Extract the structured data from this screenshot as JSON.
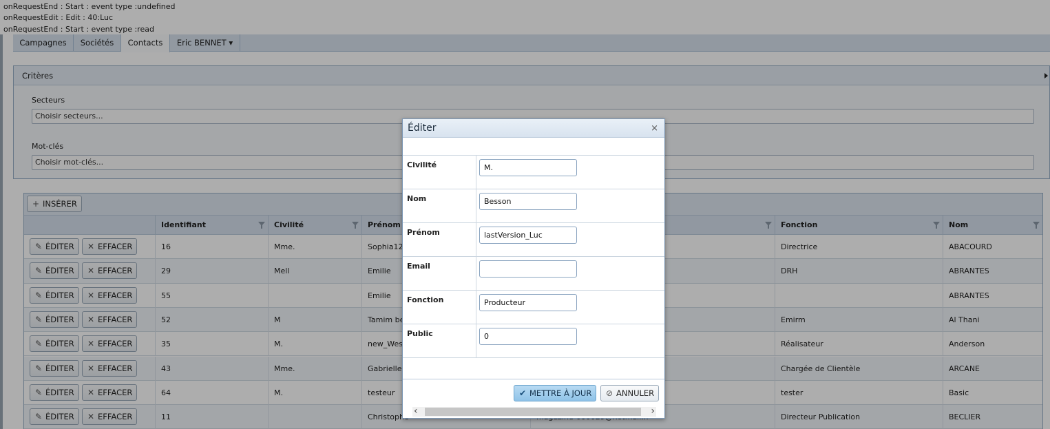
{
  "log_lines": [
    "onRequestEnd : Start : event type :undefined",
    "onRequestEdit : Edit : 40:Luc",
    "onRequestEnd : Start : event type :read"
  ],
  "tabs": [
    {
      "label": "Campagnes"
    },
    {
      "label": "Sociétés"
    },
    {
      "label": "Contacts"
    },
    {
      "label": "Eric BENNET ▾"
    }
  ],
  "criteria": {
    "title": "Critères",
    "secteurs_label": "Secteurs",
    "secteurs_placeholder": "Choisir secteurs...",
    "motcles_label": "Mot-clés",
    "motcles_placeholder": "Choisir mot-clés..."
  },
  "grid": {
    "insert_label": "INSÉRER",
    "edit_label": "ÉDITER",
    "delete_label": "EFFACER",
    "columns": [
      "Identifiant",
      "Civilité",
      "Prénom",
      "",
      "Fonction",
      "Nom"
    ],
    "rows": [
      {
        "id": "16",
        "civ": "Mme.",
        "prenom": "Sophia12",
        "email": "",
        "fonction": "Directrice",
        "nom": "ABACOURD"
      },
      {
        "id": "29",
        "civ": "Mell",
        "prenom": "Emilie",
        "email": "",
        "fonction": "DRH",
        "nom": "ABRANTES"
      },
      {
        "id": "55",
        "civ": "",
        "prenom": "Emilie",
        "email": "",
        "fonction": "",
        "nom": "ABRANTES"
      },
      {
        "id": "52",
        "civ": "M",
        "prenom": "Tamim ben",
        "email": "",
        "fonction": "Emirm",
        "nom": "Al Thani"
      },
      {
        "id": "35",
        "civ": "M.",
        "prenom": "new_Wes",
        "email": "",
        "fonction": "Réalisateur",
        "nom": "Anderson"
      },
      {
        "id": "43",
        "civ": "Mme.",
        "prenom": "Gabrielle",
        "email": "",
        "fonction": "Chargée de Clientèle",
        "nom": "ARCANE"
      },
      {
        "id": "64",
        "civ": "M.",
        "prenom": "testeur",
        "email": "",
        "fonction": "tester",
        "nom": "Basic"
      },
      {
        "id": "11",
        "civ": "",
        "prenom": "Christophe",
        "email": "magazine-000029@hotmail.fr",
        "fonction": "Directeur Publication",
        "nom": "BECLIER"
      }
    ]
  },
  "dialog": {
    "title": "Éditer",
    "close": "×",
    "fields": [
      {
        "label": "Civilité",
        "value": "M."
      },
      {
        "label": "Nom",
        "value": "Besson"
      },
      {
        "label": "Prénom",
        "value": "lastVersion_Luc"
      },
      {
        "label": "Email",
        "value": ""
      },
      {
        "label": "Fonction",
        "value": "Producteur"
      },
      {
        "label": "Public",
        "value": "0"
      }
    ],
    "update_label": "METTRE À JOUR",
    "cancel_label": "ANNULER"
  }
}
